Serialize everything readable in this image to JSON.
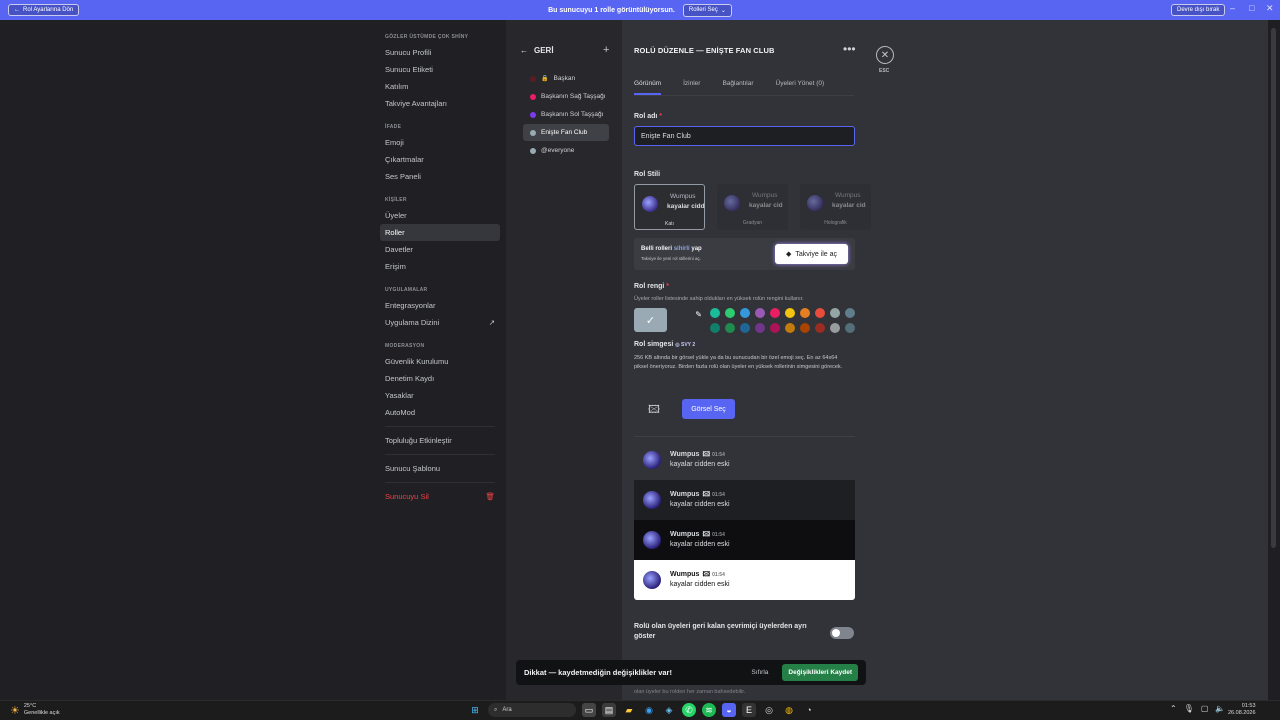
{
  "banner": {
    "back_label": "Rol Ayarlarına Dön",
    "text": "Bu sunucuyu 1 rolle görüntülüyorsun.",
    "role_select_label": "Rolleri Seç",
    "stop_label": "Devre dışı bırak"
  },
  "sidebar": {
    "sections": [
      {
        "header": "GÖZLER ÜSTÜMDE ÇOK SHİNY",
        "items": [
          "Sunucu Profili",
          "Sunucu Etiketi",
          "Katılım",
          "Takviye Avantajları"
        ]
      },
      {
        "header": "İFADE",
        "items": [
          "Emoji",
          "Çıkartmalar",
          "Ses Paneli"
        ]
      },
      {
        "header": "KİŞİLER",
        "items": [
          "Üyeler",
          "Roller",
          "Davetler",
          "Erişim"
        ]
      },
      {
        "header": "UYGULAMALAR",
        "items": [
          "Entegrasyonlar",
          "Uygulama Dizini"
        ]
      },
      {
        "header": "MODERASYON",
        "items": [
          "Güvenlik Kurulumu",
          "Denetim Kaydı",
          "Yasaklar",
          "AutoMod"
        ]
      }
    ],
    "extra1": "Topluluğu Etkinleştir",
    "extra2": "Sunucu Şablonu",
    "delete": "Sunucuyu Sil"
  },
  "roles_panel": {
    "back_label": "GERİ",
    "roles": [
      {
        "name": "Başkan",
        "color": "#5c1c24"
      },
      {
        "name": "Başkanın Sağ Taşşağı",
        "color": "#e91e63"
      },
      {
        "name": "Başkanın Sol Taşşağı",
        "color": "#7c3aed"
      },
      {
        "name": "Enişte Fan Club",
        "color": "#99aab5"
      },
      {
        "name": "@everyone",
        "color": "#99aab5"
      }
    ]
  },
  "editor": {
    "title": "ROLÜ DÜZENLE — ENİŞTE FAN CLUB",
    "esc": "ESC",
    "tabs": [
      "Görünüm",
      "İzinler",
      "Bağlantılar",
      "Üyeleri Yönet (0)"
    ],
    "role_name_label": "Rol adı",
    "role_name_value": "Enişte Fan Club",
    "role_style_label": "Rol Stili",
    "styles": [
      {
        "top": "Wumpus",
        "bottom": "kayalar cidd",
        "label": "Katı"
      },
      {
        "top": "Wumpus",
        "bottom": "kayalar cid",
        "label": "Gradyan"
      },
      {
        "top": "Wumpus",
        "bottom": "kayalar cid",
        "label": "Holografik"
      }
    ],
    "boost_title_pre": "Belli rolleri ",
    "boost_title_magic": "sihirli",
    "boost_title_post": " yap",
    "boost_sub": "Takviye ile yeni rol stillerini aç.",
    "boost_button": "Takviye ile aç",
    "color_label": "Rol rengi",
    "color_hint": "Üyeler roller listesinde sahip oldukları en yüksek rolün rengini kullanır.",
    "selected_color": "#99aab5",
    "colors_row1": [
      "#1abc9c",
      "#2ecc71",
      "#3498db",
      "#9b59b6",
      "#e91e63",
      "#f1c40f",
      "#e67e22",
      "#e74c3c",
      "#95a5a6",
      "#607d8b"
    ],
    "colors_row2": [
      "#11806a",
      "#1f8b4c",
      "#206694",
      "#71368a",
      "#ad1457",
      "#c27c0e",
      "#a84300",
      "#992d22",
      "#979c9f",
      "#546e7a"
    ],
    "icon_label": "Rol simgesi",
    "icon_badge": "SVY 2",
    "icon_desc": "256 KB altında bir görsel yükle ya da bu sunucudan bir özel emoji seç. En az 64x64 piksel öneriyoruz. Birden fazla rolü olan üyeler en yüksek rollerinin simgesini görecek.",
    "select_image": "Görsel Seç",
    "preview": {
      "name": "Wumpus",
      "time": "01:54",
      "message": "kayalar cidden eski"
    },
    "toggle_label": "Rolü olan üyeleri geri kalan çevrimiçi üyelerden ayrı göster",
    "below_text": "olan üyeler bu rolden her zaman bahsedebilir."
  },
  "savebar": {
    "warning": "Dikkat — kaydetmediğin değişiklikler var!",
    "reset": "Sıfırla",
    "save": "Değişiklikleri Kaydet"
  },
  "taskbar": {
    "temp": "25°C",
    "weather": "Genellikle açık",
    "search": "Ara",
    "time": "01:53",
    "date": "26.08.2026"
  }
}
